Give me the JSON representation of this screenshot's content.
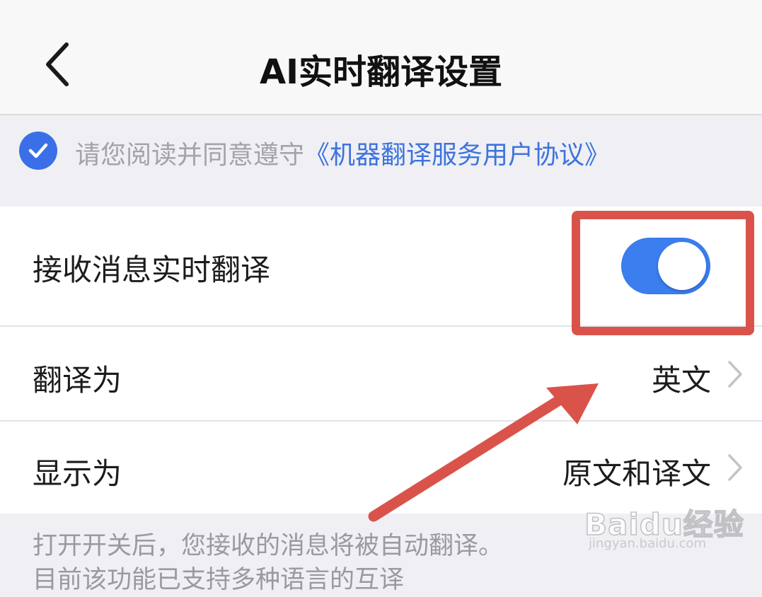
{
  "header": {
    "title": "AI实时翻译设置",
    "back_icon": "chevron-left-icon"
  },
  "agreement": {
    "checked": true,
    "prefix": "请您阅读并同意遵守",
    "link": "《机器翻译服务用户协议》"
  },
  "settings": {
    "receive_label": "接收消息实时翻译",
    "receive_enabled": true,
    "translate_to_label": "翻译为",
    "translate_to_value": "英文",
    "display_as_label": "显示为",
    "display_as_value": "原文和译文"
  },
  "footer": {
    "note_line1": "打开开关后，您接收的消息将被自动翻译。",
    "note_line2": "目前该功能已支持多种语言的互译"
  },
  "watermark": {
    "brand": "Baidu经验",
    "url": "jingyan.baidu.com"
  },
  "colors": {
    "accent": "#3b7ef0",
    "annotation": "#d9534b",
    "link": "#3d73dd"
  }
}
